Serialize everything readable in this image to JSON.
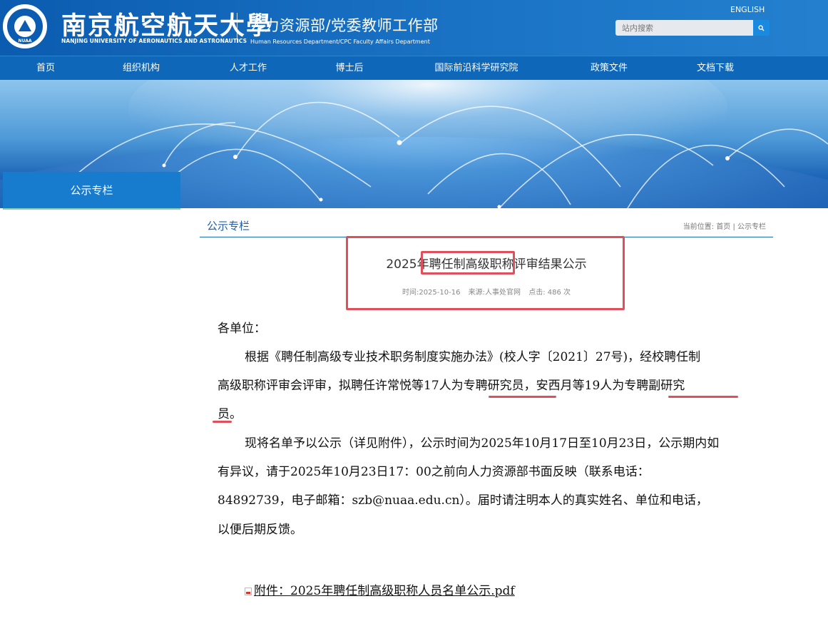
{
  "header": {
    "logo_cn": "南京航空航天大學",
    "logo_en": "NANJING UNIVERSITY OF AERONAUTICS AND ASTRONAUTICS",
    "seal_text": "NUAA",
    "dept_cn": "人力资源部/党委教师工作部",
    "dept_en": "Human Resources Department/CPC Faculty Affairs Department",
    "lang_link": "ENGLISH",
    "search_placeholder": "站内搜索",
    "search_icon": "search-icon"
  },
  "nav": {
    "items": [
      "首页",
      "组织机构",
      "人才工作",
      "博士后",
      "国际前沿科学研究院",
      "政策文件",
      "文档下载"
    ]
  },
  "sidebar": {
    "title": "公示专栏"
  },
  "content": {
    "section_title": "公示专栏",
    "breadcrumb_prefix": "当前位置:",
    "breadcrumb_home": "首页",
    "breadcrumb_sep": "|",
    "breadcrumb_current": "公示专栏"
  },
  "article": {
    "title": "2025年聘任制高级职称评审结果公示",
    "time": "时间:2025-10-16",
    "source": "来源:人事处官网",
    "clicks": "点击: 486 次",
    "salutation": "各单位：",
    "p1_line1": "根据《聘任制高级专业技术职务制度实施办法》(校人字〔2021〕27号)，经校聘任制",
    "p1_line2": "高级职称评审会评审，拟聘任许常悦等17人为专聘研究员，安西月等19人为专聘副研究",
    "p1_line3": "员。",
    "p2_line1": "现将名单予以公示（详见附件），公示时间为2025年10月17日至10月23日，公示期内如",
    "p2_line2": "有异议，请于2025年10月23日17：00之前向人力资源部书面反映（联系电话：",
    "p2_line3": "84892739，电子邮箱：szb@nuaa.edu.cn）。届时请注明本人的真实姓名、单位和电话，",
    "p2_line4": "以便后期反馈。",
    "attachment": "附件：2025年聘任制高级职称人员名单公示.pdf"
  },
  "colors": {
    "header_blue": "#0b5cb0",
    "nav_blue": "#0e67b8",
    "sidebar_blue": "#177cce",
    "highlight_red": "#e0505a"
  }
}
